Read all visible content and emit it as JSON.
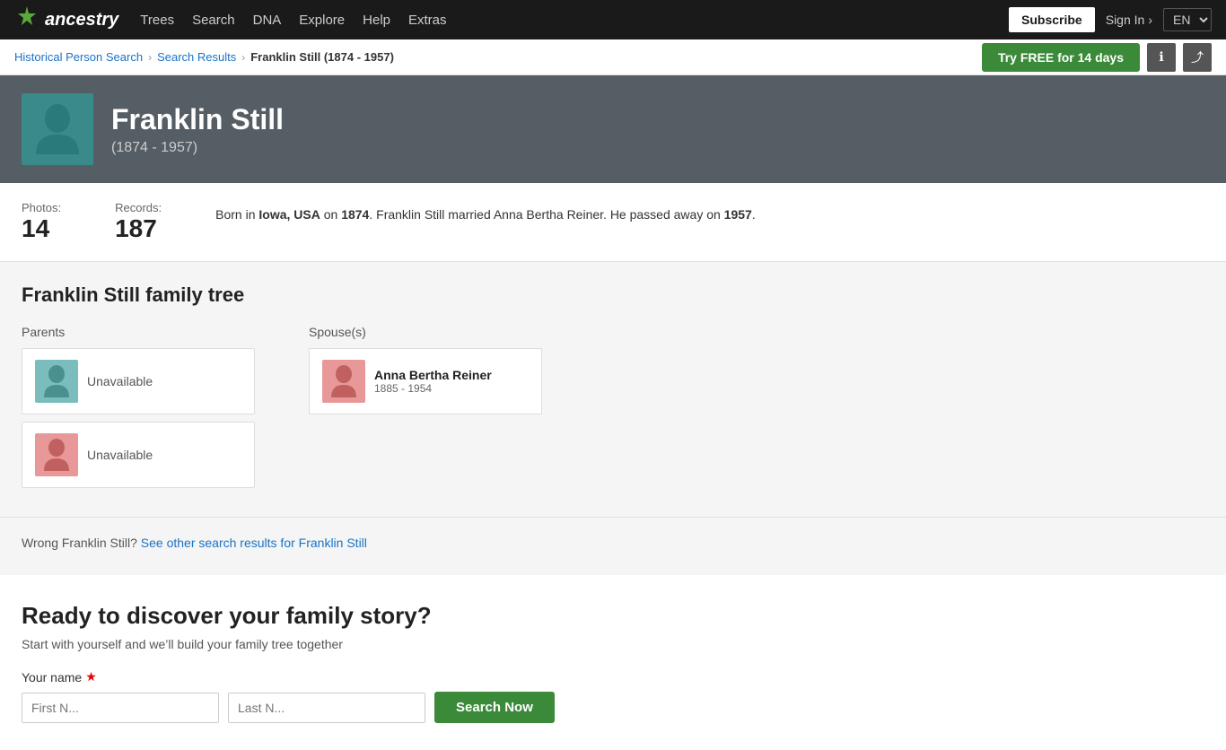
{
  "nav": {
    "logo_text": "ancestry",
    "logo_icon": "❧",
    "links": [
      "Trees",
      "Search",
      "DNA",
      "Explore",
      "Help",
      "Extras"
    ],
    "subscribe_label": "Subscribe",
    "signin_label": "Sign In",
    "signin_arrow": "›",
    "lang_label": "EN"
  },
  "breadcrumb": {
    "items": [
      {
        "label": "Historical Person Search",
        "href": "#"
      },
      {
        "label": "Search Results",
        "href": "#"
      }
    ],
    "current": "Franklin Still (1874 - 1957)",
    "try_free_label": "Try FREE for 14 days"
  },
  "profile": {
    "name": "Franklin Still",
    "years": "(1874 - 1957)",
    "photos_label": "Photos:",
    "photos_count": "14",
    "records_label": "Records:",
    "records_count": "187",
    "bio": "Born in <strong>Iowa, USA</strong> on <strong>1874</strong>. Franklin Still married Anna Bertha Reiner. He passed away on <strong>1957</strong>."
  },
  "family_tree": {
    "title": "Franklin Still family tree",
    "parents_label": "Parents",
    "spouses_label": "Spouse(s)",
    "parents": [
      {
        "name": "Unavailable",
        "gender": "male"
      },
      {
        "name": "Unavailable",
        "gender": "female"
      }
    ],
    "spouses": [
      {
        "name": "Anna Bertha Reiner",
        "years": "1885 - 1954",
        "gender": "female"
      }
    ],
    "wrong_person_text": "Wrong Franklin Still?",
    "wrong_person_link": "See other search results for Franklin Still"
  },
  "discovery": {
    "title": "Ready to discover your family story?",
    "subtitle": "Start with yourself and we’ll build your family tree together",
    "name_label": "Your name",
    "first_name_placeholder": "First N...",
    "last_name_placeholder": "Last N...",
    "search_btn_label": "Search Now"
  }
}
